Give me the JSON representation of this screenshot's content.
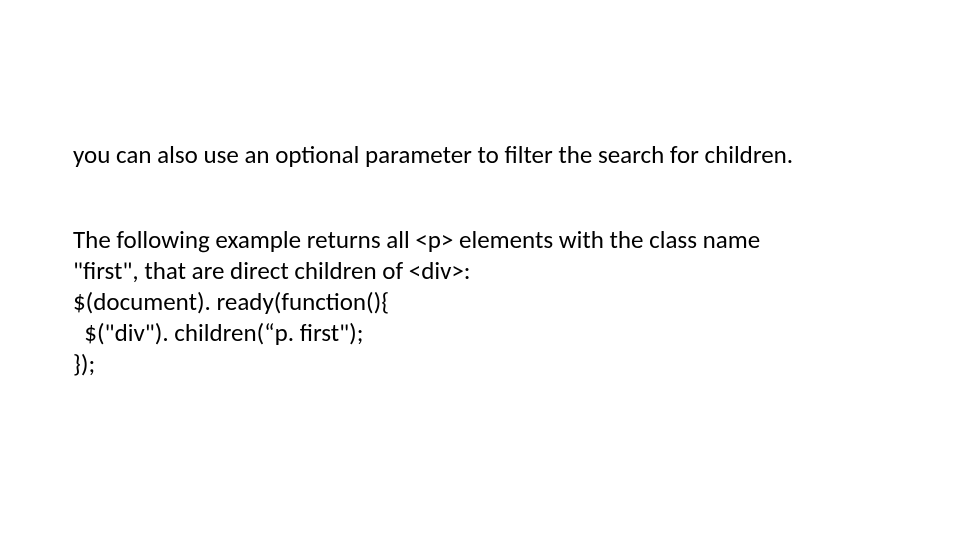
{
  "slide": {
    "line1": "you can also use an optional parameter to filter the search for children.",
    "line2": "The following example returns all <p> elements with the class name",
    "line3": "\"first\", that are direct children of <div>:",
    "code1": "$(document). ready(function(){",
    "code2": "  $(\"div\"). children(“p. first\");",
    "code3": "});"
  }
}
